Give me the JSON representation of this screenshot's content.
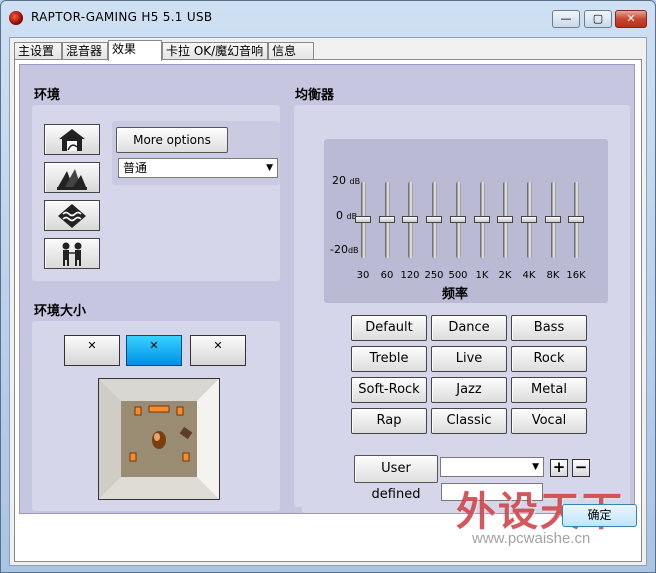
{
  "window": {
    "title": "RAPTOR-GAMING H5 5.1 USB",
    "min_glyph": "—",
    "max_glyph": "▢",
    "close_glyph": "✕"
  },
  "tabs": [
    {
      "label": "主设置",
      "active": false
    },
    {
      "label": "混音器",
      "active": false
    },
    {
      "label": "效果",
      "active": true
    },
    {
      "label": "卡拉 OK/魔幻音响",
      "active": false
    },
    {
      "label": "信息",
      "active": false
    }
  ],
  "environment": {
    "title": "环境",
    "icons": [
      "house-icon",
      "opera-house-icon",
      "underwater-icon",
      "people-icon"
    ],
    "more_options_label": "More options",
    "selected_environment": "普通"
  },
  "environment_size": {
    "title": "环境大小",
    "options": [
      {
        "name": "small-size",
        "active": false
      },
      {
        "name": "medium-size",
        "active": true
      },
      {
        "name": "large-size",
        "active": false
      }
    ]
  },
  "equalizer": {
    "title": "均衡器",
    "db_labels": {
      "top": "20",
      "mid": "0",
      "bottom": "-20",
      "unit": "dB"
    },
    "bands": [
      {
        "freq": "30",
        "gain": 0
      },
      {
        "freq": "60",
        "gain": 0
      },
      {
        "freq": "120",
        "gain": 0
      },
      {
        "freq": "250",
        "gain": 0
      },
      {
        "freq": "500",
        "gain": 0
      },
      {
        "freq": "1K",
        "gain": 0
      },
      {
        "freq": "2K",
        "gain": 0
      },
      {
        "freq": "4K",
        "gain": 0
      },
      {
        "freq": "8K",
        "gain": 0
      },
      {
        "freq": "16K",
        "gain": 0
      }
    ],
    "axis_label": "频率",
    "presets": [
      "Default",
      "Dance",
      "Bass",
      "Treble",
      "Live",
      "Rock",
      "Soft-Rock",
      "Jazz",
      "Metal",
      "Rap",
      "Classic",
      "Vocal"
    ],
    "user_defined_label": "User defined",
    "user_defined_selected": "",
    "preset_name_value": "",
    "add_glyph": "+",
    "remove_glyph": "−"
  },
  "watermark": {
    "text": "外设天下",
    "url": "www.pcwaishe.cn"
  },
  "ok_label": "确定"
}
